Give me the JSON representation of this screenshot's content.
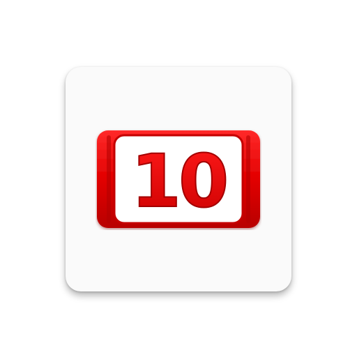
{
  "logo": {
    "number": "10",
    "colors": {
      "red": "#e20000",
      "red_dark": "#a30000",
      "frame_inner": "#ffffff",
      "tile": "#fafafa"
    }
  }
}
